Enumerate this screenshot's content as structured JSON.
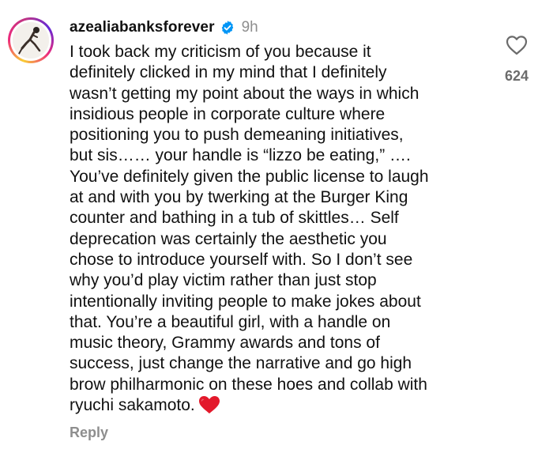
{
  "comment": {
    "username": "azealiabanksforever",
    "verified_icon": "verified-badge-icon",
    "time": "9h",
    "lines": [
      "I took back my criticism of you because it",
      "definitely clicked in my mind that I definitely",
      "wasn’t getting my point about the ways in which",
      "insidious people in corporate culture where",
      "positioning you to push demeaning initiatives,",
      "but sis…… your handle is “lizzo be eating,” ….",
      "You’ve definitely given the public license to laugh",
      "at and with you by twerking at the Burger King",
      "counter and bathing in a tub of skittles… Self",
      "deprecation was certainly the aesthetic you",
      "chose to introduce yourself with. So I don’t see",
      "why you’d play victim rather than just stop",
      "intentionally inviting people to make jokes about",
      "that. You’re a beautiful girl, with a handle on",
      "music theory, Grammy awards and tons of",
      "success, just change the narrative and go high",
      "brow philharmonic on these hoes and collab with",
      "ryuchi sakamoto."
    ],
    "end_emoji": "red-heart-emoji",
    "reply_label": "Reply",
    "like_icon": "heart-outline-icon",
    "like_count": "624"
  },
  "colors": {
    "verified_blue": "#0095f6",
    "secondary_text": "#8e8e8e",
    "emoji_red": "#e3192b"
  }
}
